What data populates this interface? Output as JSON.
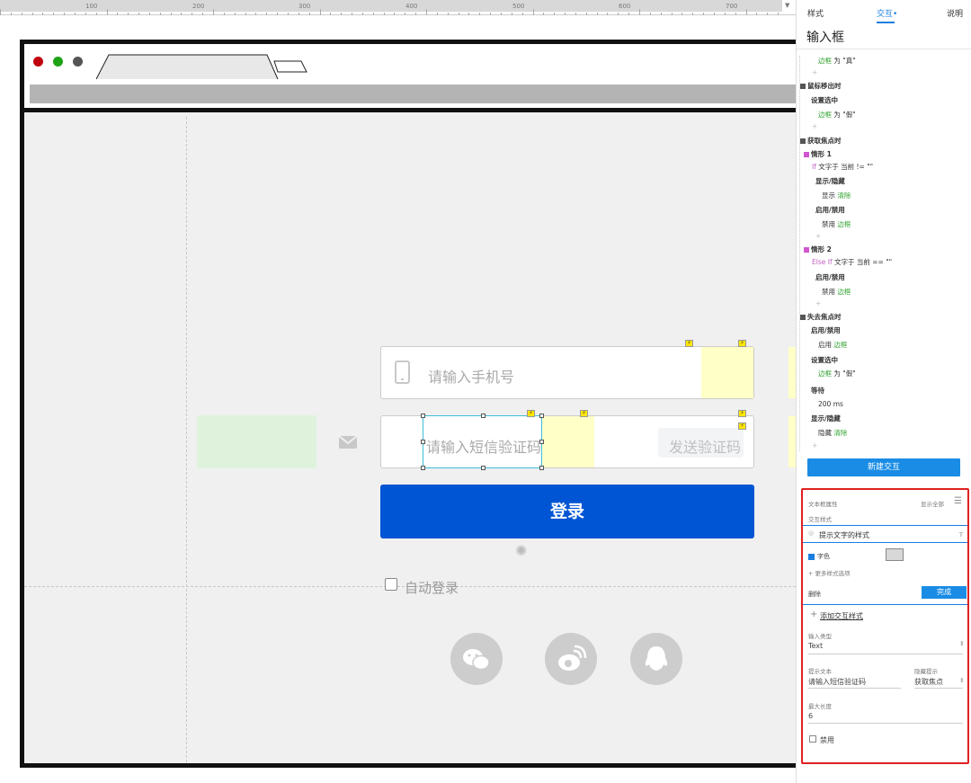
{
  "ruler": {
    "marks": [
      "100",
      "200",
      "300",
      "400",
      "500",
      "600",
      "700"
    ]
  },
  "browser": {
    "dot_colors": [
      "#c0000e",
      "#1ea317",
      "#555555"
    ]
  },
  "login": {
    "phone_placeholder": "请输入手机号",
    "sms_placeholder": "请输入短信验证码",
    "send_code_label": "发送验证码",
    "login_label": "登录",
    "auto_login_label": "自动登录",
    "social": [
      {
        "name": "wechat-icon",
        "glyph": "💬"
      },
      {
        "name": "weibo-icon",
        "glyph": "◔"
      },
      {
        "name": "qq-icon",
        "glyph": "◭"
      }
    ]
  },
  "panel": {
    "tabs": {
      "style": "样式",
      "interaction": "交互•",
      "notes": "说明"
    },
    "title": "输入框",
    "interactions": {
      "l1_green": "边框",
      "l1_rest": " 为 \"真\"",
      "mouse_out": "鼠标移出时",
      "set_selected": "设置选中",
      "l4_green": "边框",
      "l4_rest": " 为 \"假\"",
      "focus": "获取焦点时",
      "case1": "情形 1",
      "if_kw": "If ",
      "if_rest": "文字于 当前 != \"\"",
      "show_hide": "显示/隐藏",
      "show_kw": "显示 ",
      "clear": "清除",
      "enable_disable": "启用/禁用",
      "disable_kw": "禁用 ",
      "border": "边框",
      "case2": "情形 2",
      "elseif_kw": "Else If ",
      "elseif_rest": "文字于 当前 == \"\"",
      "blur": "失去焦点时",
      "enable_kw": "启用 ",
      "wait": "等待",
      "wait_val": "200 ms",
      "hide_kw": "隐藏 ",
      "new_btn": "新建交互"
    },
    "props": {
      "text_props": "文本框属性",
      "show_all": "显示全部",
      "interaction_style": "交互样式",
      "hint_style": "提示文字的样式",
      "font_color": "字色",
      "more_opts": "+ 更多样式选项",
      "delete": "删除",
      "done": "完成",
      "add_style": "添加交互样式",
      "input_type_label": "输入类型",
      "input_type_value": "Text",
      "hint_text_label": "提示文本",
      "hint_text_value": "请输入短信验证码",
      "hide_hint_label": "隐藏提示",
      "hide_hint_value": "获取焦点",
      "max_len_label": "最大长度",
      "max_len_value": "6",
      "disabled_label": "禁用"
    }
  }
}
